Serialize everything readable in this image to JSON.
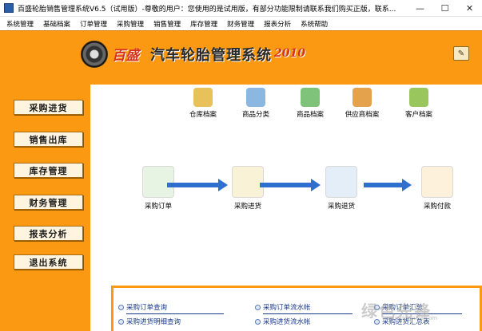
{
  "window": {
    "title": "百盛轮胎销售管理系统V6.5（试用版）-尊敬的用户：您使用的是试用版，有部分功能限制请联系我们购买正版，联系...",
    "minimize_glyph": "—",
    "maximize_glyph": "☐",
    "close_glyph": "✕"
  },
  "menu": [
    "系统管理",
    "基础档案",
    "订单管理",
    "采购管理",
    "销售管理",
    "库存管理",
    "财务管理",
    "报表分析",
    "系统帮助"
  ],
  "header": {
    "brand": "百盛",
    "system_name": "汽车轮胎管理系统",
    "year": "2010",
    "icons": [
      "tire-logo-icon",
      "settings-tool-icon"
    ]
  },
  "sidebar": [
    "采购进货",
    "销售出库",
    "库存管理",
    "财务管理",
    "报表分析",
    "退出系统"
  ],
  "top_icons": [
    {
      "label": "仓库档案",
      "icon": "warehouse-icon",
      "color": "#e8c15a"
    },
    {
      "label": "商品分类",
      "icon": "category-icon",
      "color": "#8bb7e0"
    },
    {
      "label": "商品档案",
      "icon": "product-file-icon",
      "color": "#7fc27a"
    },
    {
      "label": "供应商档案",
      "icon": "supplier-icon",
      "color": "#e3a24b"
    },
    {
      "label": "客户档案",
      "icon": "customer-icon",
      "color": "#9ac65e"
    }
  ],
  "flow": [
    {
      "label": "采购订单",
      "icon": "purchase-order-icon",
      "color": "#7fc27a"
    },
    {
      "label": "采购进货",
      "icon": "purchase-receive-icon",
      "color": "#e3c14a"
    },
    {
      "label": "采购退货",
      "icon": "purchase-return-icon",
      "color": "#6aa0d8"
    },
    {
      "label": "采购付款",
      "icon": "purchase-payment-icon",
      "color": "#f0b25a"
    }
  ],
  "links": [
    [
      "采购订单查询",
      "采购订单流水帐",
      "采购订单汇总"
    ],
    [
      "采购进货明细查询",
      "采购进货流水帐",
      "采购进货汇总表"
    ]
  ],
  "watermark": {
    "main": "绿色先锋",
    "sub": "www.downxia.com"
  },
  "colors": {
    "accent": "#fb9a12",
    "arrow": "#2f6fd0",
    "link": "#1a3a8a"
  }
}
